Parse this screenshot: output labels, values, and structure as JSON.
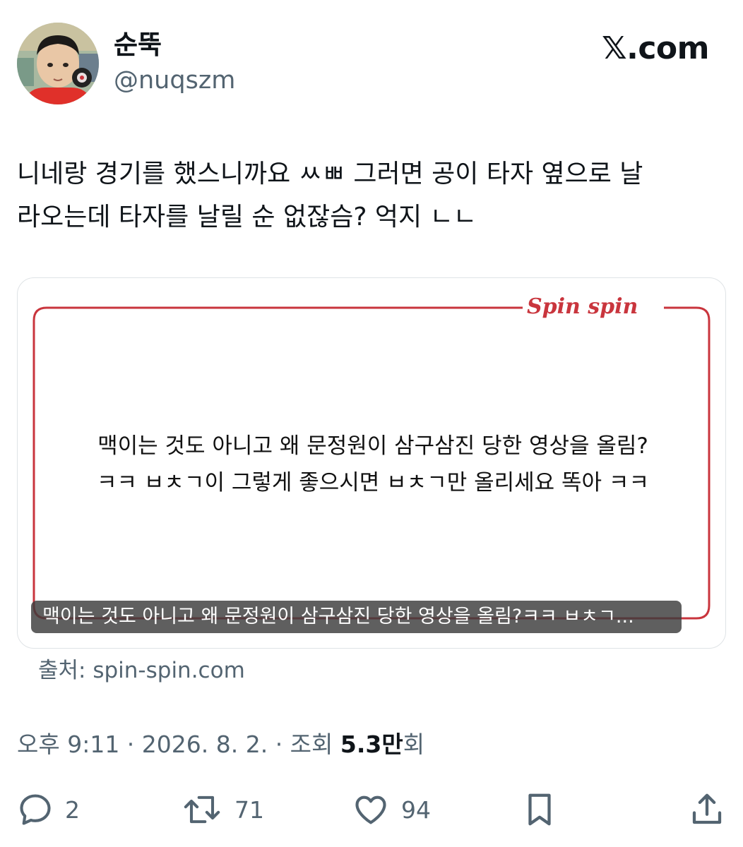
{
  "author": {
    "name": "순뚝",
    "handle": "@nuqszm"
  },
  "brand": "𝕏.com",
  "tweet": {
    "line1": "니네랑 경기를 했스니까요 ㅆㅃ 그러면 공이 타자 옆으로 날",
    "line2": "라오는데 타자를 날릴 순 없잖슴? 억지 ㄴㄴ"
  },
  "card": {
    "logo": "Spin spin",
    "body_line1": "맥이는 것도 아니고 왜 문정원이 삼구삼진 당한 영상을 올림?",
    "body_line2": "ㅋㅋ ㅂㅊㄱ이 그렇게 좋으시면 ㅂㅊㄱ만 올리세요 똑아 ㅋㅋ",
    "caption": "맥이는 것도 아니고 왜 문정원이 삼구삼진 당한 영상을 올림?ㅋㅋ ㅂㅊㄱ...",
    "frame_color": "#c9353d"
  },
  "source": "출처: spin-spin.com",
  "meta": {
    "time": "오후 9:11 · 2026. 8. 2. · 조회 ",
    "views_number": "5.3만",
    "views_suffix": "회"
  },
  "actions": {
    "reply": {
      "icon": "reply-icon",
      "count": "2"
    },
    "retweet": {
      "icon": "retweet-icon",
      "count": "71"
    },
    "like": {
      "icon": "heart-icon",
      "count": "94"
    },
    "bookmark": {
      "icon": "bookmark-icon"
    },
    "share": {
      "icon": "share-icon"
    }
  }
}
